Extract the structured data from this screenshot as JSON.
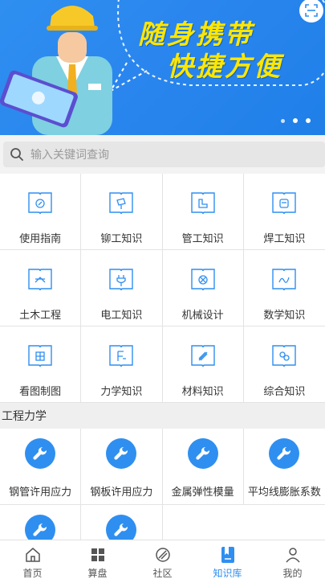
{
  "banner": {
    "slogan_line1": "随身携带",
    "slogan_line2": "快捷方便",
    "carousel_index": 1,
    "carousel_count": 3
  },
  "search": {
    "placeholder": "输入关键词查询"
  },
  "categories": [
    {
      "label": "使用指南",
      "icon": "compass-book-icon"
    },
    {
      "label": "铆工知识",
      "icon": "rivet-book-icon"
    },
    {
      "label": "管工知识",
      "icon": "pipe-book-icon"
    },
    {
      "label": "焊工知识",
      "icon": "welding-book-icon"
    },
    {
      "label": "土木工程",
      "icon": "civil-book-icon"
    },
    {
      "label": "电工知识",
      "icon": "plug-book-icon"
    },
    {
      "label": "机械设计",
      "icon": "gear-book-icon"
    },
    {
      "label": "数学知识",
      "icon": "math-book-icon"
    },
    {
      "label": "看图制图",
      "icon": "drawing-book-icon"
    },
    {
      "label": "力学知识",
      "icon": "force-book-icon"
    },
    {
      "label": "材料知识",
      "icon": "material-book-icon"
    },
    {
      "label": "综合知识",
      "icon": "general-book-icon"
    }
  ],
  "section": {
    "title": "工程力学"
  },
  "tools": [
    {
      "label": "钢管许用应力",
      "icon": "wrench-icon"
    },
    {
      "label": "钢板许用应力",
      "icon": "wrench-icon"
    },
    {
      "label": "金属弹性模量",
      "icon": "wrench-icon"
    },
    {
      "label": "平均线膨胀系数",
      "icon": "wrench-icon"
    },
    {
      "label": "",
      "icon": "wrench-icon"
    },
    {
      "label": "",
      "icon": "wrench-icon"
    }
  ],
  "tabbar": [
    {
      "label": "首页",
      "icon": "home-icon",
      "active": false
    },
    {
      "label": "算盘",
      "icon": "grid-icon",
      "active": false
    },
    {
      "label": "社区",
      "icon": "community-icon",
      "active": false
    },
    {
      "label": "知识库",
      "icon": "knowledge-icon",
      "active": true
    },
    {
      "label": "我的",
      "icon": "user-icon",
      "active": false
    }
  ],
  "colors": {
    "accent": "#2f8ff0",
    "slogan": "#ffe600"
  }
}
